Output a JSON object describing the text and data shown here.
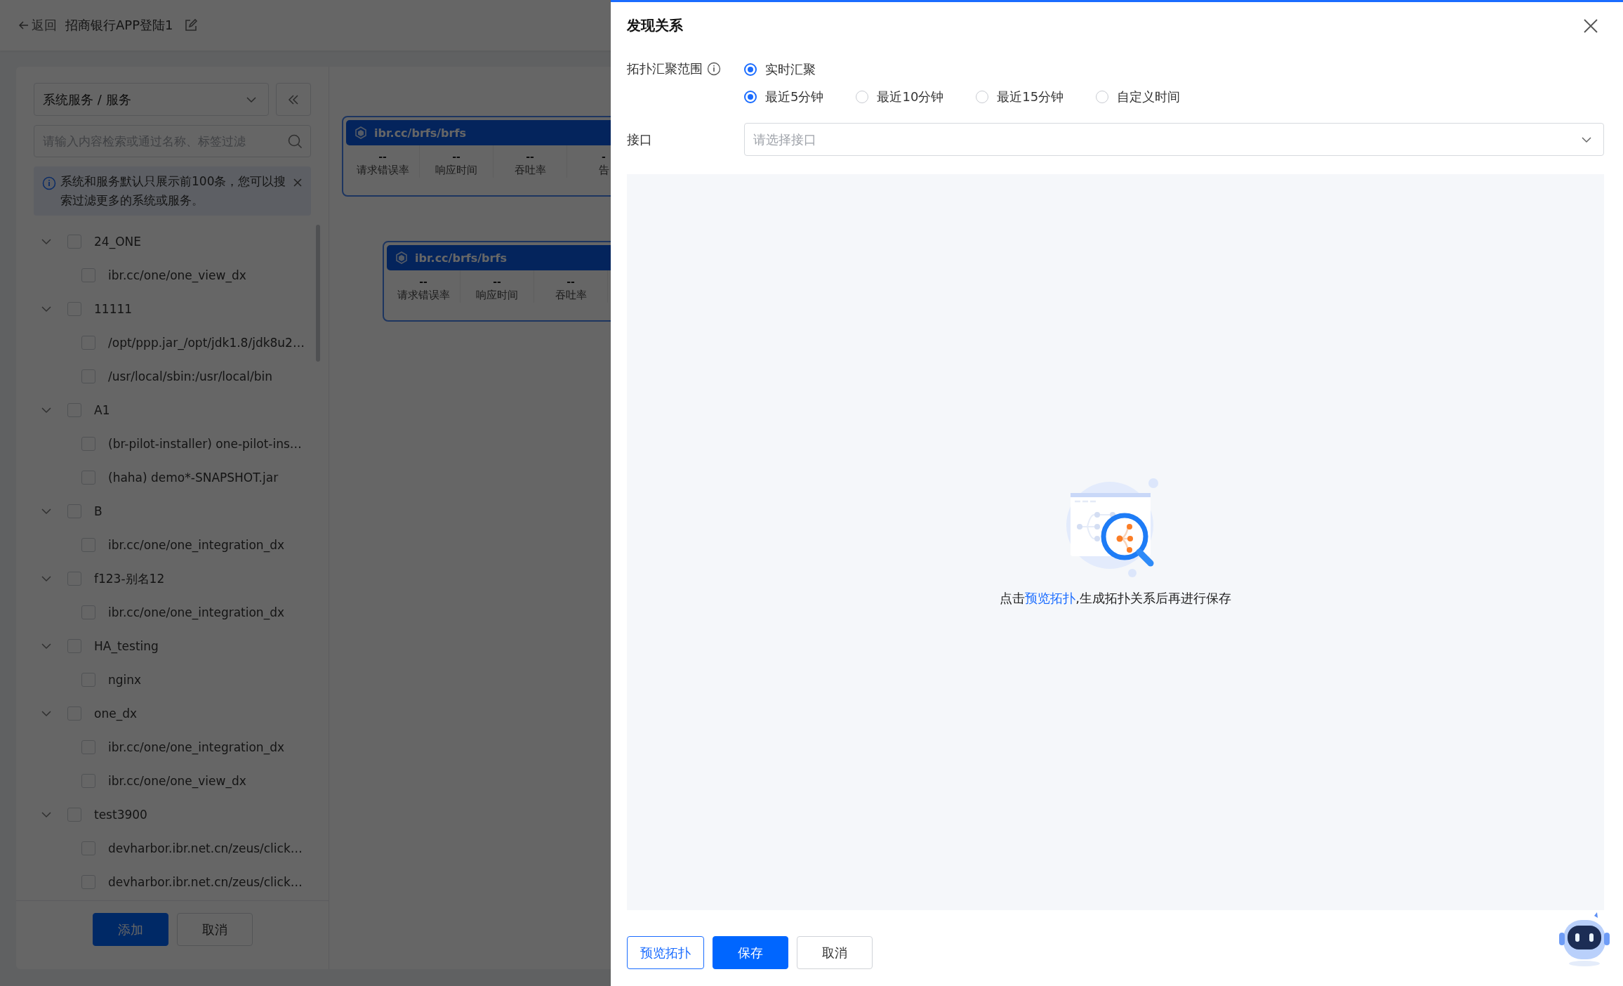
{
  "page": {
    "back": "返回",
    "title": "招商银行APP登陆1"
  },
  "sidebar": {
    "scope_select": {
      "value": "系统服务 / 服务"
    },
    "search": {
      "placeholder": "请输入内容检索或通过名称、标签过滤"
    },
    "notice": "系统和服务默认只展示前100条，您可以搜索过滤更多的系统或服务。",
    "tree": [
      {
        "label": "24_ONE",
        "expanded": true,
        "checked": false,
        "children": [
          {
            "label": "ibr.cc/one/one_view_dx",
            "checked": false
          }
        ]
      },
      {
        "label": "11111",
        "expanded": true,
        "checked": false,
        "children": [
          {
            "label": "/opt/ppp.jar_/opt/jdk1.8/jdk8u2…",
            "checked": false
          },
          {
            "label": "/usr/local/sbin:/usr/local/bin",
            "checked": false
          }
        ]
      },
      {
        "label": "A1",
        "expanded": true,
        "checked": false,
        "children": [
          {
            "label": "(br-pilot-installer) one-pilot-ins…",
            "checked": false
          },
          {
            "label": "(haha) demo*-SNAPSHOT.jar",
            "checked": false
          }
        ]
      },
      {
        "label": "B",
        "expanded": true,
        "checked": false,
        "children": [
          {
            "label": "ibr.cc/one/one_integration_dx",
            "checked": false
          }
        ]
      },
      {
        "label": "f123-别名12",
        "expanded": true,
        "checked": false,
        "children": [
          {
            "label": "ibr.cc/one/one_integration_dx",
            "checked": false
          }
        ]
      },
      {
        "label": "HA_testing",
        "expanded": true,
        "checked": false,
        "children": [
          {
            "label": "nginx",
            "checked": false
          }
        ]
      },
      {
        "label": "one_dx",
        "expanded": true,
        "checked": false,
        "children": [
          {
            "label": "ibr.cc/one/one_integration_dx",
            "checked": false
          },
          {
            "label": "ibr.cc/one/one_view_dx",
            "checked": false
          }
        ]
      },
      {
        "label": "test3900",
        "expanded": true,
        "checked": false,
        "children": [
          {
            "label": "devharbor.ibr.net.cn/zeus/click…",
            "checked": false
          },
          {
            "label": "devharbor.ibr.net.cn/zeus/click…",
            "checked": false
          }
        ]
      }
    ],
    "buttons": [
      {
        "label": "添加",
        "kind": "primary"
      },
      {
        "label": "取消",
        "kind": "default"
      }
    ]
  },
  "canvas": {
    "nodes": [
      {
        "title": "ibr.cc/brfs/brfs",
        "metrics": [
          {
            "value": "--",
            "label": "请求错误率"
          },
          {
            "value": "--",
            "label": "响应时间"
          },
          {
            "value": "--",
            "label": "吞吐率"
          },
          {
            "value": "-",
            "label": "告"
          }
        ]
      },
      {
        "title": "ibr.cc/brfs/brfs",
        "metrics": [
          {
            "value": "--",
            "label": "请求错误率"
          },
          {
            "value": "--",
            "label": "响应时间"
          },
          {
            "value": "--",
            "label": "吞吐率"
          }
        ]
      }
    ]
  },
  "drawer": {
    "title": "发现关系",
    "aggregation": {
      "label": "拓扑汇聚范围",
      "modes": [
        {
          "label": "实时汇聚",
          "selected": true
        }
      ],
      "ranges": [
        {
          "label": "最近5分钟",
          "selected": true
        },
        {
          "label": "最近10分钟",
          "selected": false
        },
        {
          "label": "最近15分钟",
          "selected": false
        },
        {
          "label": "自定义时间",
          "selected": false
        }
      ]
    },
    "interface": {
      "label": "接口",
      "placeholder": "请选择接口"
    },
    "empty_state": {
      "before": "点击",
      "link": "预览拓扑",
      "after": ",生成拓扑关系后再进行保存"
    },
    "buttons": [
      {
        "label": "预览拓扑",
        "kind": "outline"
      },
      {
        "label": "保存",
        "kind": "primary"
      },
      {
        "label": "取消",
        "kind": "default"
      }
    ]
  }
}
